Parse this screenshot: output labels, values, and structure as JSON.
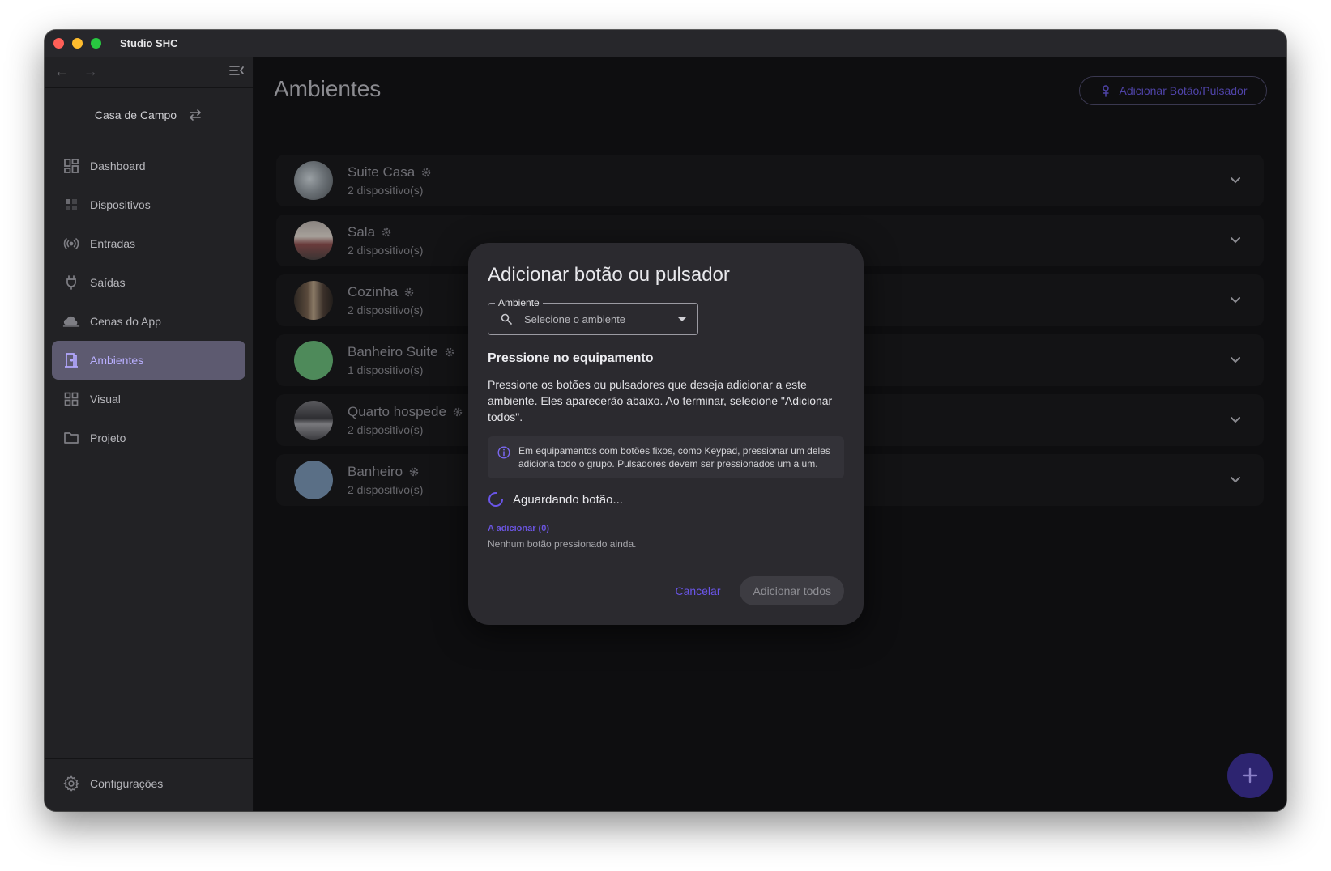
{
  "window": {
    "title": "Studio SHC"
  },
  "sidebar": {
    "home": "Casa de Campo",
    "items": [
      {
        "label": "Dashboard",
        "icon": "dashboard-icon"
      },
      {
        "label": "Dispositivos",
        "icon": "devices-icon"
      },
      {
        "label": "Entradas",
        "icon": "sensors-icon"
      },
      {
        "label": "Saídas",
        "icon": "plug-icon"
      },
      {
        "label": "Cenas do App",
        "icon": "cloud-icon"
      },
      {
        "label": "Ambientes",
        "icon": "door-icon",
        "active": true
      },
      {
        "label": "Visual",
        "icon": "grid-icon"
      },
      {
        "label": "Projeto",
        "icon": "folder-icon"
      }
    ],
    "settings": "Configurações"
  },
  "main": {
    "title": "Ambientes",
    "add_button": "Adicionar Botão/Pulsador",
    "rooms": [
      {
        "name": "Suite Casa",
        "count": "2 dispositivo(s)",
        "avatar_color": "#6b7176"
      },
      {
        "name": "Sala",
        "count": "2 dispositivo(s)",
        "avatar_color": "#5c4a47"
      },
      {
        "name": "Cozinha",
        "count": "2 dispositivo(s)",
        "avatar_color": "#4a3d33"
      },
      {
        "name": "Banheiro Suite",
        "count": "1 dispositivo(s)",
        "avatar_color": "#4e8a5a"
      },
      {
        "name": "Quarto hospede",
        "count": "2 dispositivo(s)",
        "avatar_color": "#4d4d50"
      },
      {
        "name": "Banheiro",
        "count": "2 dispositivo(s)",
        "avatar_color": "#5a6f86"
      }
    ]
  },
  "dialog": {
    "title": "Adicionar botão ou pulsador",
    "field_label": "Ambiente",
    "field_placeholder": "Selecione o ambiente",
    "section_title": "Pressione no equipamento",
    "description": "Pressione os botões ou pulsadores que deseja adicionar a este ambiente. Eles aparecerão abaixo. Ao terminar, selecione \"Adicionar todos\".",
    "info": "Em equipamentos com botões fixos, como Keypad, pressionar um deles adiciona todo o grupo. Pulsadores devem ser pressionados um a um.",
    "waiting": "Aguardando botão...",
    "to_add_title": "A adicionar (0)",
    "to_add_empty": "Nenhum botão pressionado ainda.",
    "cancel": "Cancelar",
    "add_all": "Adicionar todos"
  },
  "colors": {
    "accent": "#6a55e8",
    "active_nav_bg": "#5d5a70",
    "dialog_bg": "#2b2a2f"
  }
}
